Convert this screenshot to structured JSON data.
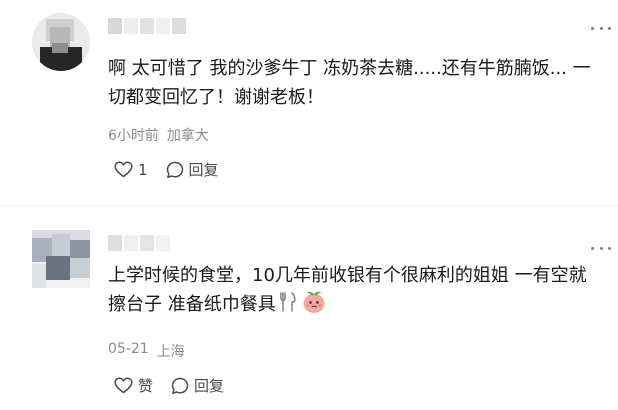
{
  "comments": [
    {
      "text": "啊 太可惜了 我的沙爹牛丁 冻奶茶去糖.....还有牛筋腩饭... 一切都变回忆了！谢谢老板！",
      "time": "6小时前",
      "location": "加拿大",
      "like_label": "1",
      "reply_label": "回复",
      "avatar_icon": "avatar-blurred",
      "colors": {
        "avatar_bg": "#e9e9e9"
      }
    },
    {
      "text": "上学时候的食堂，10几年前收银有个很麻利的姐姐 一有空就擦台子 准备纸巾餐具",
      "emoji_1": "fork-and-knife-emoji",
      "emoji_2": "peach-face-emoji",
      "time": "05-21",
      "location": "上海",
      "like_label": "赞",
      "reply_label": "回复",
      "avatar_icon": "avatar-blurred"
    }
  ],
  "colors": {
    "text": "#1a1a1a",
    "meta": "#8a8a8a",
    "action": "#4a4a4a",
    "more_dots": "#7d7d7d"
  }
}
